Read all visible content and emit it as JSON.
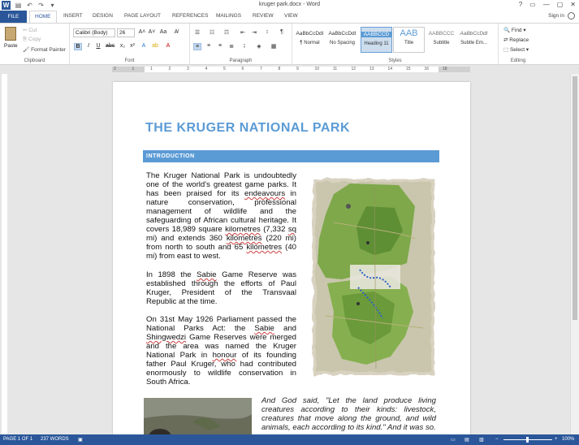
{
  "window": {
    "title": "kruger park.docx - Word",
    "controls": [
      "?",
      "▭",
      "—",
      "▢",
      "✕"
    ]
  },
  "quick_access": {
    "icons": [
      "save-icon",
      "undo-icon",
      "redo-icon",
      "customize-icon"
    ]
  },
  "tabs": {
    "file": "FILE",
    "items": [
      "HOME",
      "INSERT",
      "DESIGN",
      "PAGE LAYOUT",
      "REFERENCES",
      "MAILINGS",
      "REVIEW",
      "VIEW"
    ],
    "active": "HOME",
    "sign_in": "Sign in"
  },
  "ribbon": {
    "clipboard": {
      "paste": "Paste",
      "cut": "Cut",
      "copy": "Copy",
      "format_painter": "Format Painter",
      "label": "Clipboard"
    },
    "font": {
      "family": "Calibri (Body)",
      "size": "26",
      "label": "Font",
      "bold": "B",
      "italic": "I",
      "underline": "U"
    },
    "paragraph": {
      "label": "Paragraph",
      "pilcrow": "¶"
    },
    "styles": {
      "label": "Styles",
      "items": [
        {
          "sample": "AaBbCcDdI",
          "name": "¶ Normal"
        },
        {
          "sample": "AaBbCcDdI",
          "name": "No Spacing"
        },
        {
          "sample": "AABBCCD",
          "name": "Heading 11"
        },
        {
          "sample": "AAB",
          "name": "Title"
        },
        {
          "sample": "AABBCCC",
          "name": "Subtitle"
        },
        {
          "sample": "AaBbCcDdI",
          "name": "Subtle Em..."
        }
      ],
      "selected_index": 2
    },
    "editing": {
      "find": "Find",
      "replace": "Replace",
      "select": "Select",
      "label": "Editing"
    }
  },
  "ruler": {
    "numbers": [
      "2",
      "1",
      "1",
      "2",
      "3",
      "4",
      "5",
      "6",
      "7",
      "8",
      "9",
      "10",
      "11",
      "12",
      "13",
      "14",
      "15",
      "16",
      "18"
    ]
  },
  "document": {
    "title": "THE KRUGER NATIONAL PARK",
    "section": "INTRODUCTION",
    "p1": [
      {
        "t": "The Kruger National Park is undoubtedly one of the world's greatest game parks. It has been praised for its "
      },
      {
        "t": "endeavours",
        "sq": true
      },
      {
        "t": " in nature conservation, professional management of wildlife and the safeguarding of African cultural heritage. It covers 18,989 square "
      },
      {
        "t": "kilometres",
        "sq": true
      },
      {
        "t": " (7,332 "
      },
      {
        "t": "sq",
        "sq": true
      },
      {
        "t": " mi) and extends 360 "
      },
      {
        "t": "kilometres",
        "sq": true
      },
      {
        "t": " (220 mi) from north to south and 65 "
      },
      {
        "t": "kilometres",
        "sq": true
      },
      {
        "t": " (40 mi) from east to west."
      }
    ],
    "p2": [
      {
        "t": "In 1898 the "
      },
      {
        "t": "Sabie",
        "sq": true
      },
      {
        "t": " Game Reserve was established through the efforts of Paul Kruger, President of the Transvaal Republic at the time."
      }
    ],
    "p3": [
      {
        "t": "On 31st May 1926 Parliament passed the National Parks Act: the "
      },
      {
        "t": "Sabie",
        "sq": true
      },
      {
        "t": " and "
      },
      {
        "t": "Shingwedzi",
        "sq": true
      },
      {
        "t": " Game Reserves were merged and the area was named the Kruger National Park in "
      },
      {
        "t": "honour",
        "sq": true
      },
      {
        "t": " of its founding father Paul Kruger, who had contributed enormously to wildlife conservation in South Africa."
      }
    ],
    "quote": "And God said, \"Let the land produce living creatures according to their kinds: livestock, creatures that move along the ground, and wild animals, each according to its kind.\" And it was so."
  },
  "status": {
    "page": "PAGE 1 OF 1",
    "words": "237 WORDS",
    "zoom": "100%"
  },
  "colors": {
    "accent": "#2b579a",
    "heading": "#5b9bd5"
  }
}
